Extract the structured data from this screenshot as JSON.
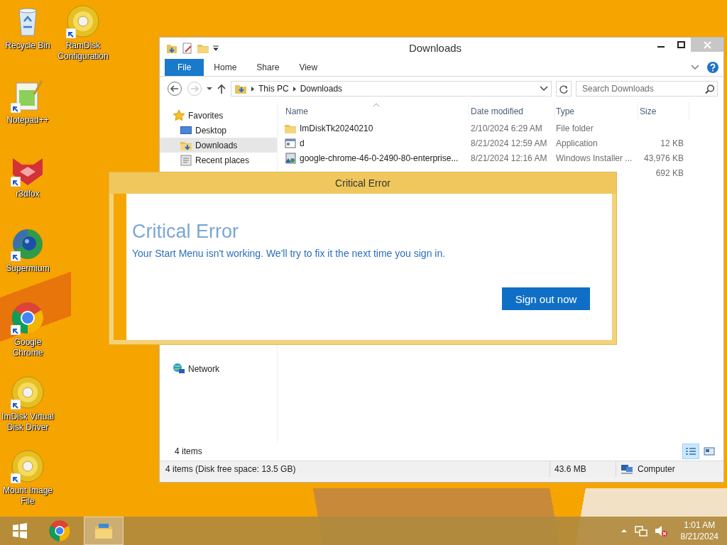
{
  "desktop_icons": [
    {
      "label": "Recycle Bin",
      "kind": "recycle",
      "shortcut": false
    },
    {
      "label": "RamDisk Configuration",
      "kind": "disc",
      "shortcut": true
    },
    {
      "label": "Notepad++",
      "kind": "notepad",
      "shortcut": true
    },
    {
      "label": "r3dfox",
      "kind": "fox",
      "shortcut": true
    },
    {
      "label": "Supermium",
      "kind": "supermium",
      "shortcut": true
    },
    {
      "label": "Google Chrome",
      "kind": "chrome",
      "shortcut": true
    },
    {
      "label": "ImDisk Virtual Disk Driver",
      "kind": "disc",
      "shortcut": true
    },
    {
      "label": "Mount Image File",
      "kind": "disc",
      "shortcut": true
    }
  ],
  "explorer": {
    "title": "Downloads",
    "ribbon_tabs": [
      {
        "label": "File",
        "kind": "menu"
      },
      {
        "label": "Home",
        "kind": "tab"
      },
      {
        "label": "Share",
        "kind": "tab"
      },
      {
        "label": "View",
        "kind": "tab"
      }
    ],
    "address": [
      "This PC",
      "Downloads"
    ],
    "search": {
      "placeholder": "Search Downloads"
    },
    "nav": [
      {
        "label": "Favorites",
        "kind": "favorites",
        "children": [
          {
            "label": "Desktop",
            "kind": "desktop",
            "selected": false
          },
          {
            "label": "Downloads",
            "kind": "downloads",
            "selected": true
          },
          {
            "label": "Recent places",
            "kind": "recent",
            "selected": false
          }
        ]
      },
      {
        "label": "Network",
        "kind": "network"
      }
    ],
    "columns": [
      "Name",
      "Date modified",
      "Type",
      "Size"
    ],
    "files": [
      {
        "kind": "folder",
        "name": "ImDiskTk20240210",
        "date": "2/10/2024 6:29 AM",
        "type": "File folder"
      },
      {
        "kind": "app",
        "name": "d",
        "date": "8/21/2024 12:59 AM",
        "type": "Application",
        "size": "12 KB"
      },
      {
        "kind": "installer",
        "name": "google-chrome-46-0-2490-80-enterprise...",
        "date": "8/21/2024 12:16 AM",
        "type": "Windows Installer ...",
        "size": "43,976 KB"
      },
      {
        "kind": "covered",
        "size": "692 KB"
      }
    ],
    "item_count": "4 items",
    "views": [
      {
        "kind": "details",
        "selected": true
      },
      {
        "kind": "tiles",
        "selected": false
      }
    ],
    "status": {
      "summary": "4 items (Disk free space: 13.5 GB)",
      "size": "43.6 MB",
      "location": "Computer"
    }
  },
  "dialog": {
    "title": "Critical Error",
    "heading": "Critical Error",
    "message": "Your Start Menu isn't working. We'll try to fix it the next time you sign in.",
    "button": "Sign out now"
  },
  "taskbar": {
    "apps": [
      {
        "kind": "start",
        "active": false
      },
      {
        "kind": "chrome",
        "active": false
      },
      {
        "kind": "explorer",
        "active": true
      }
    ],
    "time": "1:01 AM",
    "date": "8/21/2024"
  }
}
